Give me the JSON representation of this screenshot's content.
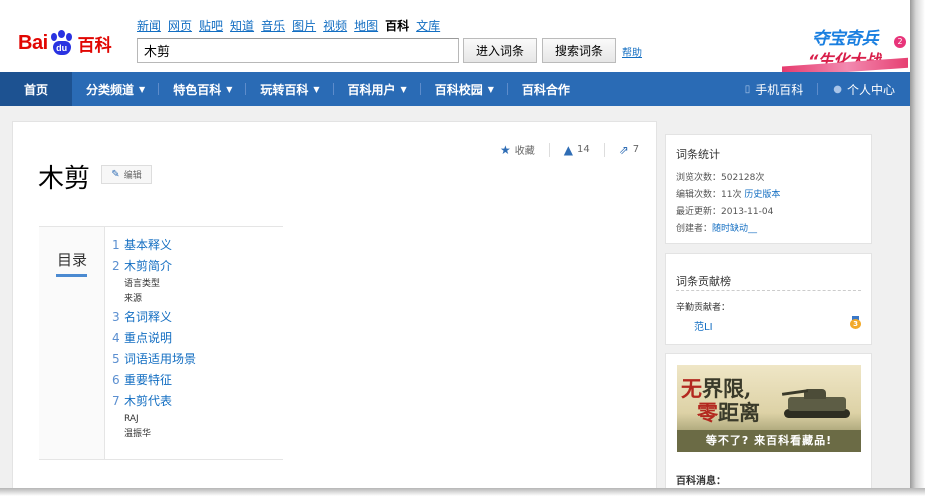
{
  "logo": {
    "bai": "Bai",
    "du": "du",
    "baike": "百科"
  },
  "topnav": [
    "新闻",
    "网页",
    "贴吧",
    "知道",
    "音乐",
    "图片",
    "视频",
    "地图",
    "百科",
    "文库"
  ],
  "topnav_active": "百科",
  "search": {
    "value": "木剪",
    "enter_button": "进入词条",
    "search_button": "搜索词条",
    "help": "帮助"
  },
  "banner": {
    "line1": "夺宝奇兵",
    "line2": "“生化大战",
    "badge": "2"
  },
  "mainnav": {
    "home": "首页",
    "items": [
      "分类频道",
      "特色百科",
      "玩转百科",
      "百科用户",
      "百科校园",
      "百科合作"
    ],
    "mobile": "手机百科",
    "user_center": "个人中心"
  },
  "actions": {
    "favorite": "收藏",
    "likes": "14",
    "shares": "7"
  },
  "entry": {
    "title": "木剪",
    "edit": "编辑"
  },
  "toc": {
    "label": "目录",
    "items": [
      {
        "num": "1",
        "text": "基本释义",
        "subs": []
      },
      {
        "num": "2",
        "text": "木剪简介",
        "subs": [
          "语言类型",
          "来源"
        ]
      },
      {
        "num": "3",
        "text": "名词释义",
        "subs": []
      },
      {
        "num": "4",
        "text": "重点说明",
        "subs": []
      },
      {
        "num": "5",
        "text": "词语适用场景",
        "subs": []
      },
      {
        "num": "6",
        "text": "重要特征",
        "subs": []
      },
      {
        "num": "7",
        "text": "木剪代表",
        "subs": [
          "RAJ",
          "温振华"
        ]
      }
    ]
  },
  "stats": {
    "title": "词条统计",
    "views_label": "浏览次数：",
    "views": "502128次",
    "edits_label": "编辑次数：",
    "edits": "11次",
    "history": "历史版本",
    "updated_label": "最近更新：",
    "updated": "2013-11-04",
    "creator_label": "创建者：",
    "creator": "随时缺动__"
  },
  "contrib": {
    "title": "词条贡献榜",
    "sub": "辛勤贡献者：",
    "user": "范LI",
    "medal": "3"
  },
  "ad": {
    "line1_a": "无",
    "line1_b": "界限,",
    "line2_a": "零",
    "line2_b": "距离",
    "footer": "等不了? 来百科看藏品!"
  },
  "news_title": "百科消息："
}
